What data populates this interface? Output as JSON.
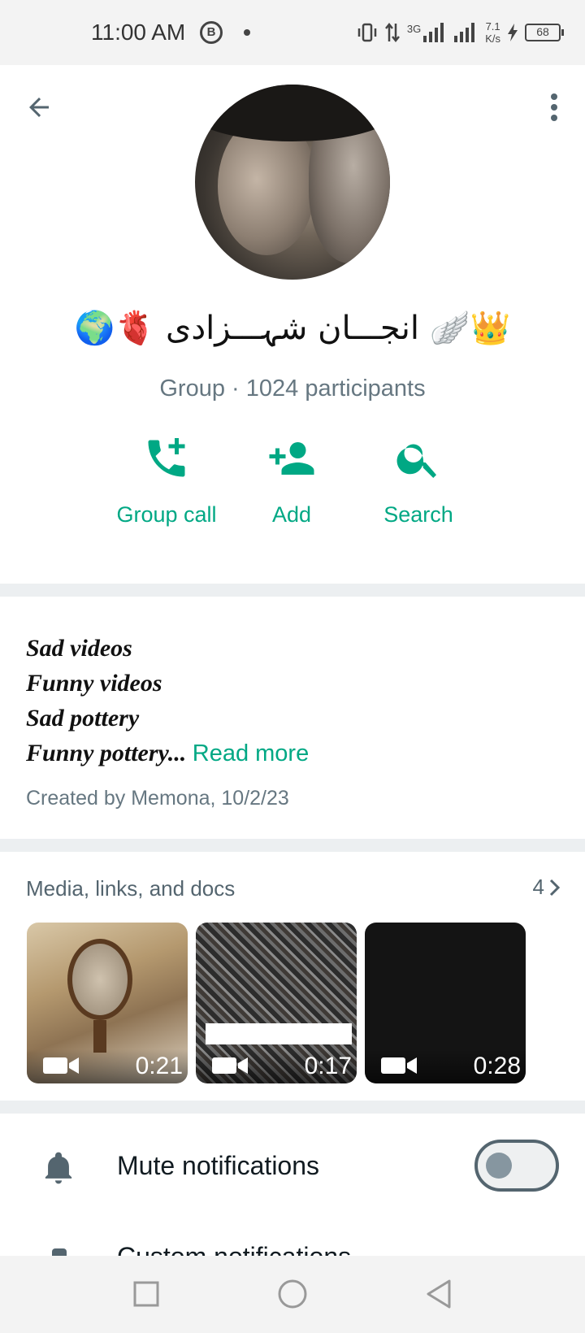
{
  "status_bar": {
    "time": "11:00 AM",
    "b_badge": "B",
    "network_type": "3G",
    "speed_value": "7.1",
    "speed_unit": "K/s",
    "battery": "68"
  },
  "header": {
    "group_name": "🌍🫀 انجـــان شہـــزادی 🪽👑",
    "meta": "Group · 1024 participants",
    "actions": [
      {
        "label": "Group call",
        "icon": "add-call-icon"
      },
      {
        "label": "Add",
        "icon": "add-person-icon"
      },
      {
        "label": "Search",
        "icon": "search-icon"
      }
    ]
  },
  "description": {
    "lines": [
      "Sad videos",
      "Funny videos",
      "Sad pottery",
      "Funny pottery"
    ],
    "ellipsis": "...",
    "read_more": "Read more",
    "created": "Created by Memona, 10/2/23"
  },
  "media": {
    "title": "Media, links, and docs",
    "count": "4",
    "items": [
      {
        "duration": "0:21",
        "icon": "video-camera-icon"
      },
      {
        "duration": "0:17",
        "icon": "video-camera-icon"
      },
      {
        "duration": "0:28",
        "icon": "video-camera-icon"
      }
    ]
  },
  "settings": {
    "mute_label": "Mute notifications",
    "mute_enabled": false,
    "next_label": "Custom notifications"
  },
  "colors": {
    "accent": "#00a884",
    "secondary_text": "#667781",
    "divider_bg": "#eceff1"
  }
}
